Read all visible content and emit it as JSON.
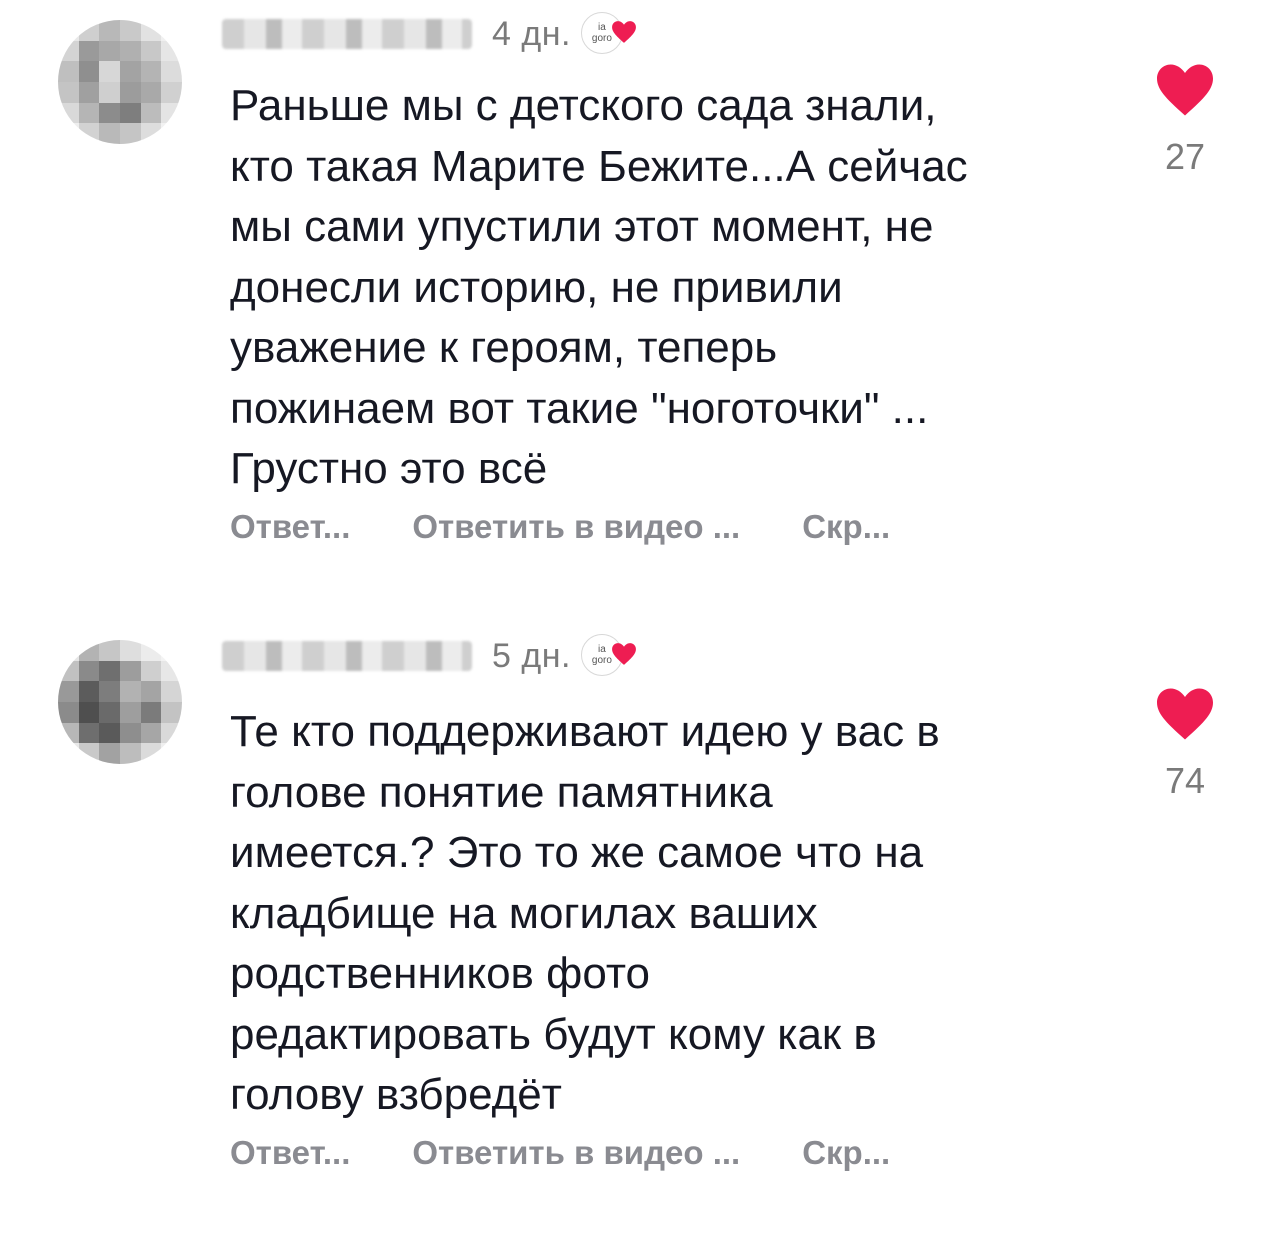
{
  "comments": [
    {
      "time": "4 дн.",
      "badge_text_1": "ia",
      "badge_text_2": "goro",
      "text": "Раньше мы с детского сада знали,\nкто такая Марите Бежите...А сейчас\nмы сами упустили этот момент, не\nдонесли историю, не привили\nуважение к героям, теперь\nпожинаем вот такие \"ноготочки\" ...\nГрустно это всё",
      "like_count": "27",
      "actions": {
        "reply": "Ответ...",
        "video_reply": "Ответить в видео ...",
        "hide": "Скр..."
      }
    },
    {
      "time": "5 дн.",
      "badge_text_1": "ia",
      "badge_text_2": "goro",
      "text": "Те кто поддерживают идею у вас в\nголове понятие памятника\nимеется.? Это то же самое что на\nкладбище на могилах ваших\nродственников фото\nредактировать будут кому как в\nголову взбредёт",
      "like_count": "74",
      "actions": {
        "reply": "Ответ...",
        "video_reply": "Ответить в видео ...",
        "hide": "Скр..."
      }
    }
  ],
  "colors": {
    "like_heart": "#ee1d52",
    "secondary_text": "#8a8b91",
    "primary_text": "#161823"
  },
  "icons": {
    "like": "heart-icon",
    "creator_liked": "heart-icon"
  }
}
